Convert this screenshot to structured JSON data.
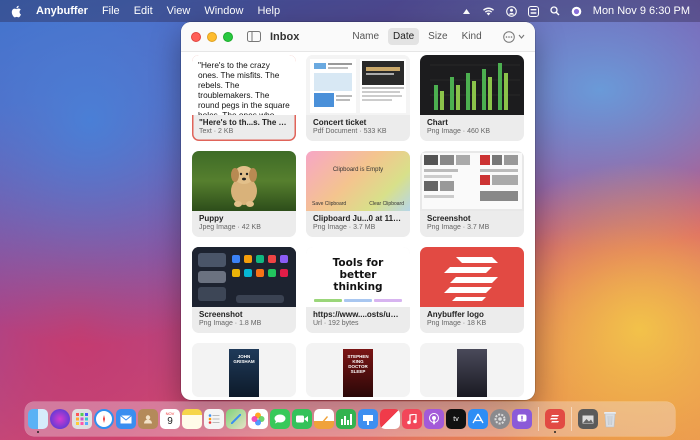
{
  "menubar": {
    "app_name": "Anybuffer",
    "items": [
      "File",
      "Edit",
      "View",
      "Window",
      "Help"
    ],
    "datetime": "Mon Nov 9  6:30 PM"
  },
  "window": {
    "title": "Inbox",
    "sort_tabs": [
      {
        "label": "Name",
        "active": false
      },
      {
        "label": "Date",
        "active": true
      },
      {
        "label": "Size",
        "active": false
      },
      {
        "label": "Kind",
        "active": false
      }
    ]
  },
  "items": [
    {
      "title": "\"Here's to th...s. The rebels",
      "subtitle": "Text · 2 KB",
      "thumb_text": "\"Here's to the crazy ones. The misfits. The rebels. The troublemakers. The round pegs in the square holes. The ones who see t..."
    },
    {
      "title": "Concert ticket",
      "subtitle": "Pdf Document · 533 KB"
    },
    {
      "title": "Chart",
      "subtitle": "Png Image · 460 KB"
    },
    {
      "title": "Puppy",
      "subtitle": "Jpeg Image · 42 KB"
    },
    {
      "title": "Clipboard Ju...0 at 11:42 AM",
      "subtitle": "Png Image · 3.7 MB",
      "thumb_text": "Clipboard is Empty",
      "thumb_left": "Save Clipboard",
      "thumb_right": "Clear Clipboard"
    },
    {
      "title": "Screenshot",
      "subtitle": "Png Image · 3.7 MB"
    },
    {
      "title": "Screenshot",
      "subtitle": "Png Image · 1.8 MB"
    },
    {
      "title": "https://www....osts/untools",
      "subtitle": "Url · 192 bytes",
      "thumb_text": "Tools for better thinking"
    },
    {
      "title": "Anybuffer logo",
      "subtitle": "Png Image · 18 KB"
    }
  ],
  "partial_books": [
    "JOHN GRISHAM",
    "STEPHEN KING DOCTOR SLEEP",
    ""
  ],
  "dock": {
    "calendar_month": "NOV",
    "calendar_day": "9",
    "colors": {
      "finder": "#4aa3f0",
      "siri": "#5a4fd6",
      "launchpad": "#d8d8d8",
      "safari": "#2f8ff0",
      "mail": "#3a8ef0",
      "contacts": "#b48a5a",
      "calendar": "#ffffff",
      "notes": "#f6d54a",
      "reminders": "#f5f5f5",
      "maps": "#6cc36a",
      "photos": "#f4f4f4",
      "messages": "#38c95a",
      "facetime": "#34c25a",
      "pages": "#f0a23a",
      "numbers": "#33b34f",
      "keynote": "#3d8ff0",
      "news": "#f03b4a",
      "music": "#f2475a",
      "podcasts": "#a35ad8",
      "tv": "#111111",
      "appstore": "#2d8df5",
      "settings": "#8a8a8e",
      "feedback": "#8b5ad8",
      "anybuffer": "#e24a43",
      "preview": "#5a5a5a",
      "trash": "#d9dde2"
    }
  }
}
